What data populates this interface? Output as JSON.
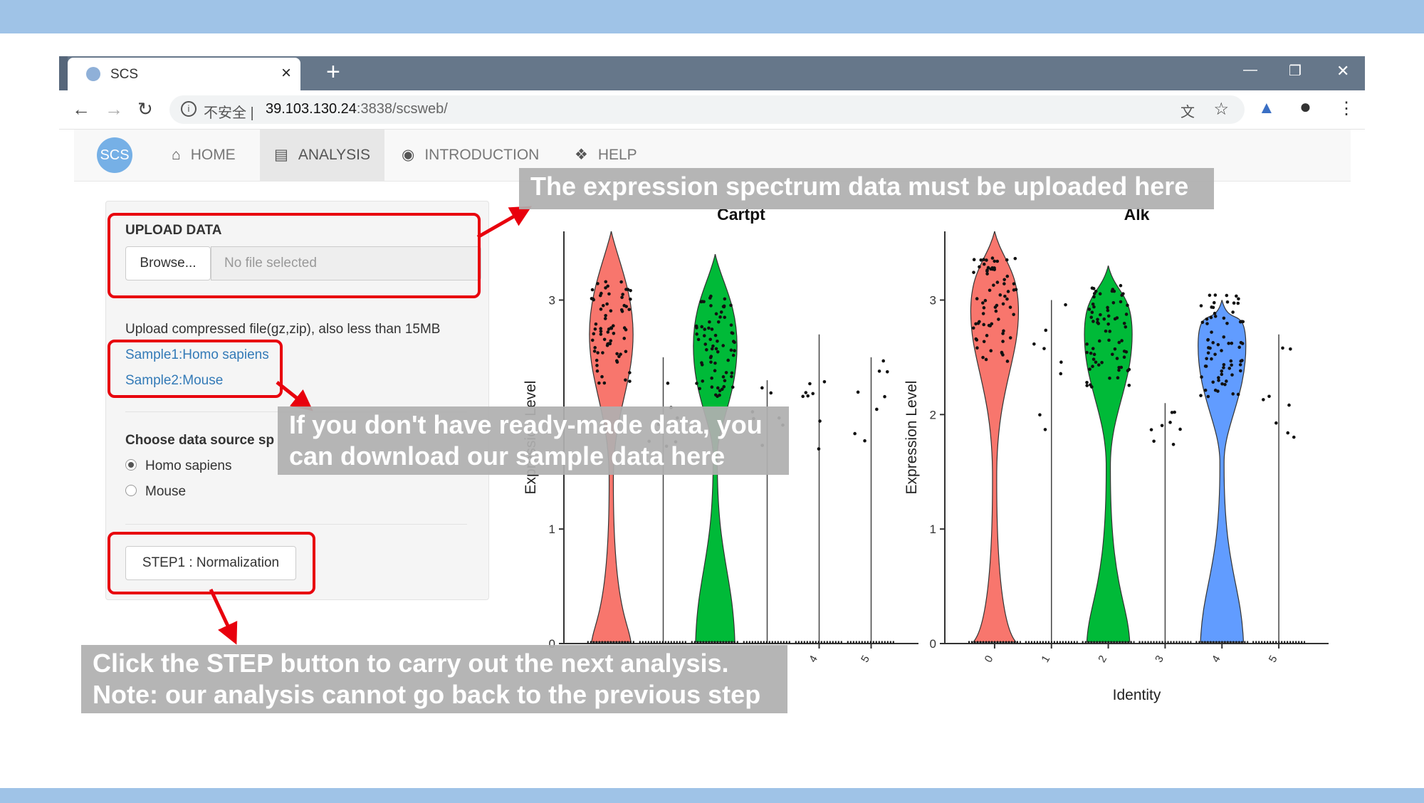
{
  "browser": {
    "tab_title": "SCS",
    "tab_close": "×",
    "new_tab": "+",
    "security_label": "不安全 |",
    "url_host": "39.103.130.24",
    "url_rest": ":3838/scsweb/"
  },
  "app": {
    "logo_text": "SCS",
    "nav": [
      {
        "label": "HOME",
        "icon": "home-icon"
      },
      {
        "label": "ANALYSIS",
        "icon": "bar-chart-icon"
      },
      {
        "label": "INTRODUCTION",
        "icon": "globe-icon"
      },
      {
        "label": "HELP",
        "icon": "tag-icon"
      }
    ],
    "active_nav": "ANALYSIS"
  },
  "sidebar": {
    "upload_title": "UPLOAD DATA",
    "browse_label": "Browse...",
    "file_placeholder": "No file selected",
    "upload_help": "Upload compressed file(gz,zip), also less than 15MB",
    "sample1": "Sample1:Homo sapiens",
    "sample2": "Sample2:Mouse",
    "species_title": "Choose data source sp",
    "species_options": [
      "Homo sapiens",
      "Mouse"
    ],
    "species_selected": "Homo sapiens",
    "step_button": "STEP1 : Normalization"
  },
  "callouts": {
    "upload": "The expression spectrum data must be uploaded here",
    "sample_line1": "If you don't have ready-made data, you",
    "sample_line2": "can download our sample data here",
    "step_line1": "Click the STEP button to carry out the next analysis.",
    "step_line2": "Note: our analysis cannot go back to the previous step"
  },
  "colors": {
    "accent_red": "#e8000d",
    "band_blue": "#9fc3e7",
    "cluster0": "#f8766d",
    "cluster2": "#00ba38",
    "cluster4": "#619cff"
  },
  "chart_data": [
    {
      "type": "violin",
      "title": "Cartpt",
      "ylabel": "Expression Level",
      "yticks": [
        0,
        1,
        3
      ],
      "ylim": [
        0,
        3.6
      ],
      "categories": [
        "4",
        "5"
      ],
      "violins": [
        {
          "cluster": "0",
          "color": "#f8766d",
          "max": 3.6,
          "upper_center": 2.7,
          "zero_bulge": 0.25
        },
        {
          "cluster": "1",
          "color": "#f8766d",
          "max": 2.5,
          "upper_center": 0,
          "zero_bulge": 0
        },
        {
          "cluster": "2",
          "color": "#00ba38",
          "max": 3.4,
          "upper_center": 2.6,
          "zero_bulge": 0.7
        },
        {
          "cluster": "3",
          "color": "#619cff",
          "max": 2.3,
          "upper_center": 0,
          "zero_bulge": 0
        },
        {
          "cluster": "4",
          "color": "#619cff",
          "max": 2.7,
          "upper_center": 0,
          "zero_bulge": 0
        },
        {
          "cluster": "5",
          "color": "#619cff",
          "max": 2.5,
          "upper_center": 0,
          "zero_bulge": 0
        }
      ]
    },
    {
      "type": "violin",
      "title": "Alk",
      "xlabel": "Identity",
      "ylabel": "Expression Level",
      "yticks": [
        0,
        1,
        2,
        3
      ],
      "ylim": [
        0,
        3.6
      ],
      "categories": [
        "0",
        "1",
        "2",
        "3",
        "4",
        "5"
      ],
      "violins": [
        {
          "cluster": "0",
          "color": "#f8766d",
          "max": 3.6,
          "upper_center": 2.9,
          "zero_bulge": 0.1
        },
        {
          "cluster": "1",
          "color": "#f8766d",
          "max": 3.0,
          "upper_center": 0,
          "zero_bulge": 0
        },
        {
          "cluster": "2",
          "color": "#00ba38",
          "max": 3.3,
          "upper_center": 2.7,
          "zero_bulge": 0.45
        },
        {
          "cluster": "3",
          "color": "#619cff",
          "max": 2.1,
          "upper_center": 0,
          "zero_bulge": 0
        },
        {
          "cluster": "4",
          "color": "#619cff",
          "max": 3.0,
          "upper_center": 2.6,
          "zero_bulge": 0.6
        },
        {
          "cluster": "5",
          "color": "#619cff",
          "max": 2.7,
          "upper_center": 0,
          "zero_bulge": 0
        }
      ]
    }
  ]
}
